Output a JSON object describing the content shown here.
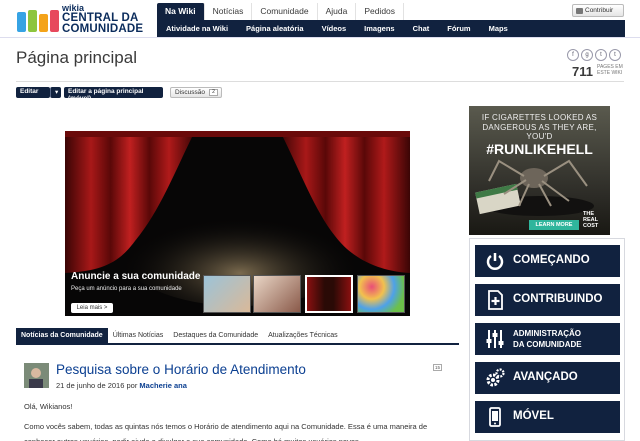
{
  "logo": {
    "small": "wikia",
    "line1": "CENTRAL DA",
    "line2": "COMUNIDADE"
  },
  "topnav": [
    "Na Wiki",
    "Notícias",
    "Comunidade",
    "Ajuda",
    "Pedidos"
  ],
  "subnav": [
    "Atividade na Wiki",
    "Página aleatória",
    "Vídeos",
    "Imagens",
    "Chat",
    "Fórum",
    "Maps"
  ],
  "contribute_label": "Contribuir",
  "page": {
    "title": "Página principal",
    "count": "711",
    "count_label": "PAGES EM ESTE WIKI",
    "social": [
      "f",
      "g",
      "t",
      "t"
    ]
  },
  "actions": {
    "edit": "Editar",
    "edit_mobile": "Editar a página principal (móvel)",
    "discussion": "Discussão",
    "discussion_count": "2"
  },
  "hero": {
    "title": "Anuncie a sua comunidade",
    "subtitle": "Peça um anúncio para a sua comunidade",
    "button": "Leia mais >"
  },
  "content_tabs": [
    "Notícias da Comunidade",
    "Últimas Notícias",
    "Destaques da Comunidade",
    "Atualizações Técnicas"
  ],
  "post": {
    "title": "Pesquisa sobre o Horário de Atendimento",
    "date": "21 de junho de 2016 por ",
    "author": "Macherie ana",
    "comments": "15",
    "greeting": "Olá, Wikianos!",
    "body": "Como vocês sabem, todas as quintas nós temos o Horário de atendimento aqui na Comunidade. Essa é uma maneira de conhecer outros usuários, pedir ajuda e divulgar a sua comunidade. Como há muitos usuários novos"
  },
  "ad": {
    "line1": "IF CIGARETTES LOOKED AS",
    "line2": "DANGEROUS AS THEY ARE, YOU'D",
    "hashtag": "#RUNLIKEHELL",
    "learn": "LEARN MORE",
    "brand": "THE REAL COST"
  },
  "rightnav": [
    {
      "label": "COMEÇANDO",
      "icon": "power-icon"
    },
    {
      "label": "CONTRIBUINDO",
      "icon": "add-page-icon"
    },
    {
      "label": "ADMINISTRAÇÃO",
      "label2": "DA COMUNIDADE",
      "icon": "sliders-icon"
    },
    {
      "label": "AVANÇADO",
      "icon": "gears-icon"
    },
    {
      "label": "MÓVEL",
      "icon": "phone-icon"
    }
  ],
  "colors": {
    "navy": "#11223f",
    "link": "#0b3f91",
    "teal": "#2fb59c"
  }
}
